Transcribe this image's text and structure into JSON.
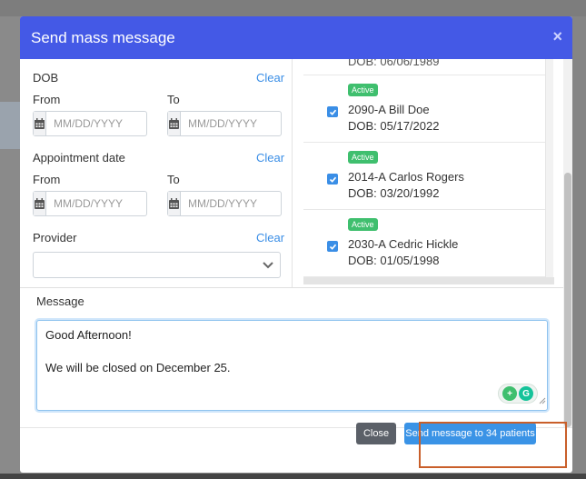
{
  "modal": {
    "title": "Send mass message",
    "close_glyph": "×"
  },
  "filters": {
    "dob": {
      "label": "DOB",
      "clear": "Clear",
      "from_label": "From",
      "to_label": "To",
      "from_placeholder": "MM/DD/YYYY",
      "to_placeholder": "MM/DD/YYYY"
    },
    "appointment": {
      "label": "Appointment date",
      "clear": "Clear",
      "from_label": "From",
      "to_label": "To",
      "from_placeholder": "MM/DD/YYYY",
      "to_placeholder": "MM/DD/YYYY"
    },
    "provider": {
      "label": "Provider",
      "clear": "Clear",
      "selected": ""
    }
  },
  "patients": {
    "previous_dob": "DOB: 06/06/1989",
    "items": [
      {
        "status": "Active",
        "name": "2090-A Bill Doe",
        "dob": "DOB: 05/17/2022",
        "checked": true
      },
      {
        "status": "Active",
        "name": "2014-A Carlos Rogers",
        "dob": "DOB: 03/20/1992",
        "checked": true
      },
      {
        "status": "Active",
        "name": "2030-A Cedric Hickle",
        "dob": "DOB: 01/05/1998",
        "checked": true
      }
    ]
  },
  "message": {
    "label": "Message",
    "text": "Good Afternoon!\n\nWe will be closed on December 25."
  },
  "footer": {
    "close_label": "Close",
    "send_label": "Send message to 34 patients"
  },
  "colors": {
    "header": "#4459e6",
    "accent": "#3a8ee6",
    "active_badge": "#3fbf6e",
    "close_button": "#5b6068",
    "highlight": "#c95f2a"
  }
}
